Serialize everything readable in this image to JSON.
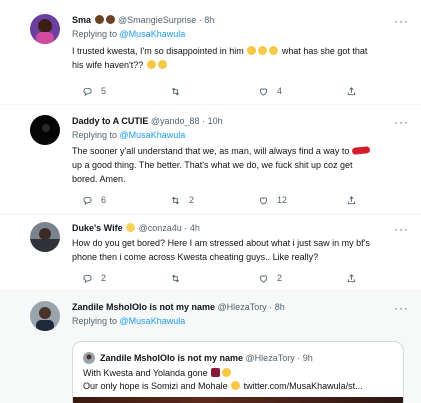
{
  "tweets": [
    {
      "name": "Sma",
      "handle": "@SmangieSurprise",
      "time": "8h",
      "replying_to_label": "Replying to",
      "replying_to": "@MusaKhawula",
      "text_1": "I trusted kwesta, I'm so disappointed in him",
      "text_1_end": "what has she got that",
      "text_2": "his wife haven't??",
      "replies": "5",
      "retweets": "",
      "likes": "4"
    },
    {
      "name": "Daddy to A CUTIE",
      "handle": "@yando_88",
      "time": "10h",
      "replying_to_label": "Replying to",
      "replying_to": "@MusaKhawula",
      "text_1": "The sooner y'all understand that we, as man, will always find a way to",
      "text_2": "up a good thing. The better. That's what we do, we fuck shit up coz get",
      "text_3": "bored. Amen.",
      "replies": "6",
      "retweets": "2",
      "likes": "12"
    },
    {
      "name": "Duke's Wife",
      "handle": "@conza4u",
      "time": "4h",
      "text_1": "How do you get bored? Here I am stressed about what i just saw in my bf's",
      "text_2": "phone then i come across Kwesta cheating guys.. Like really?",
      "replies": "2",
      "retweets": "",
      "likes": "2"
    },
    {
      "name": "Zandile MsholOlo is not my name",
      "handle": "@HlezaTory",
      "time": "8h",
      "replying_to_label": "Replying to",
      "replying_to": "@MusaKhawula"
    }
  ],
  "quote": {
    "name": "Zandile MsholOlo is not my name",
    "handle": "@HlezaTory",
    "time": "9h",
    "text_1": "With Kwesta and Yolanda gone",
    "text_2": "Our only hope is Somizi and Mohale",
    "link": "twitter.com/MusaKhawula/st..."
  },
  "dot": "·",
  "colors": {
    "link": "#1d9bf0",
    "secondary": "#536471",
    "highlight_bg": "#f7f9f9"
  },
  "icons": [
    "reply-icon",
    "retweet-icon",
    "like-icon",
    "share-icon",
    "more-icon"
  ]
}
